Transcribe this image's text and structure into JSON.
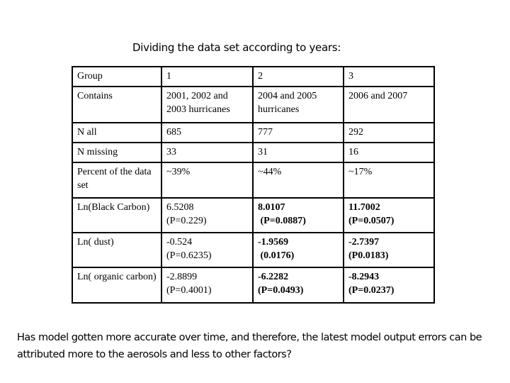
{
  "title": "Dividing the data set according to years:",
  "table": {
    "rows": [
      {
        "label": "Group",
        "cells": [
          {
            "text": "1"
          },
          {
            "text": "2"
          },
          {
            "text": "3"
          }
        ]
      },
      {
        "label": "Contains",
        "cells": [
          {
            "text": "2001, 2002 and 2003 hurricanes"
          },
          {
            "text": "2004 and 2005 hurricanes"
          },
          {
            "text": "2006 and 2007"
          }
        ]
      },
      {
        "label": "N all",
        "cells": [
          {
            "text": "685"
          },
          {
            "text": "777"
          },
          {
            "text": "292"
          }
        ]
      },
      {
        "label": "N missing",
        "cells": [
          {
            "text": "33"
          },
          {
            "text": "31"
          },
          {
            "text": "16"
          }
        ]
      },
      {
        "label": "Percent of the data set",
        "cells": [
          {
            "text": "~39%"
          },
          {
            "text": "~44%"
          },
          {
            "text": "~17%"
          }
        ]
      },
      {
        "label": "Ln(Black Carbon)",
        "cells": [
          {
            "value": "6.5208",
            "p": "(P=0.229)",
            "bold": false
          },
          {
            "value": "8.0107",
            "p": " (P=0.0887)",
            "bold": true
          },
          {
            "value": "11.7002",
            "p": "(P=0.0507)",
            "bold": true
          }
        ]
      },
      {
        "label": "Ln( dust)",
        "cells": [
          {
            "value": "-0.524",
            "p": "(P=0.6235)",
            "bold": false
          },
          {
            "value": "-1.9569",
            "p": " (0.0176)",
            "bold": true
          },
          {
            "value": "-2.7397",
            "p": "(P0.0183)",
            "bold": true
          }
        ]
      },
      {
        "label": "Ln( organic carbon)",
        "cells": [
          {
            "value": "-2.8899",
            "p": "(P=0.4001)",
            "bold": false
          },
          {
            "value": "-6.2282",
            "p": "(P=0.0493)",
            "bold": true
          },
          {
            "value": "-8.2943",
            "p": "(P=0.0237)",
            "bold": true
          }
        ]
      }
    ]
  },
  "question": "Has model gotten more accurate over time, and therefore, the latest model output errors can be attributed more to the aerosols and less to other factors?"
}
